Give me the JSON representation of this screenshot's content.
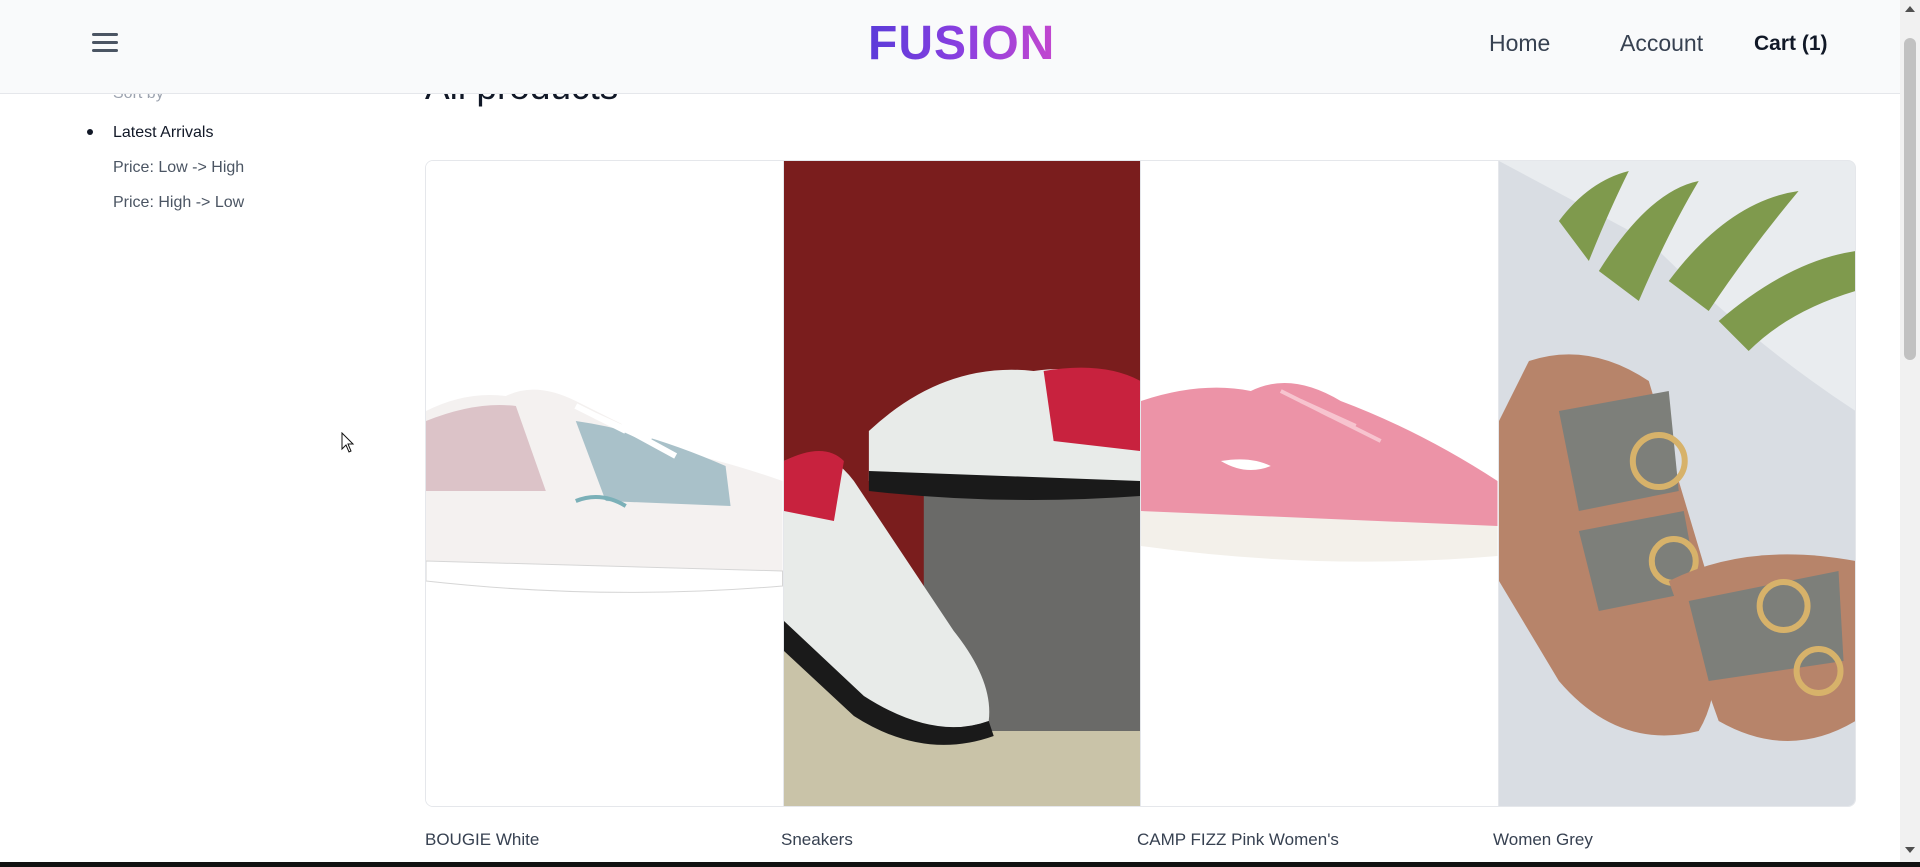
{
  "header": {
    "logo": "FUSION",
    "nav": {
      "home": "Home",
      "account": "Account",
      "cart": "Cart (1)"
    }
  },
  "sidebar": {
    "sort_label": "Sort by",
    "sort_options": [
      {
        "label": "Latest Arrivals",
        "active": true
      },
      {
        "label": "Price: Low -> High",
        "active": false
      },
      {
        "label": "Price: High -> Low",
        "active": false
      }
    ]
  },
  "main": {
    "title": "All products",
    "products": [
      {
        "title": "BOUGIE White",
        "image": "white-pink-sneaker"
      },
      {
        "title": "Sneakers",
        "image": "black-red-sneakers-pair"
      },
      {
        "title": "CAMP FIZZ Pink Women's",
        "image": "pink-running-shoe"
      },
      {
        "title": "Women Grey",
        "image": "grey-buckle-sandals"
      }
    ]
  },
  "colors": {
    "logo_gradient_start": "#5b3bd9",
    "logo_gradient_end": "#c347cf"
  }
}
